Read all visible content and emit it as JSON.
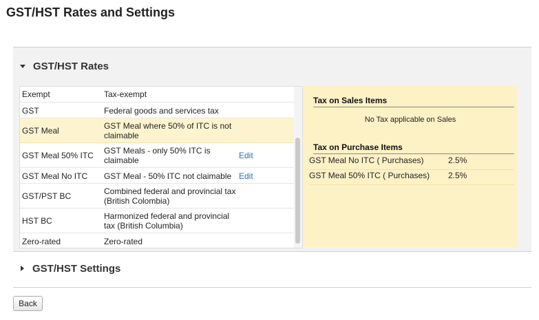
{
  "page_title": "GST/HST Rates and Settings",
  "rates_section": {
    "title": "GST/HST Rates"
  },
  "rates": [
    {
      "code": "Exempt",
      "description": "Tax-exempt",
      "edit": ""
    },
    {
      "code": "GST",
      "description": "Federal goods and services tax",
      "edit": ""
    },
    {
      "code": "GST Meal",
      "description": "GST Meal where 50% of ITC is not claimable",
      "edit": ""
    },
    {
      "code": "GST Meal 50% ITC",
      "description": "GST Meals - only 50% ITC is claimable",
      "edit": "Edit"
    },
    {
      "code": "GST Meal No ITC",
      "description": "GST Meal - 50% ITC not claimable",
      "edit": "Edit"
    },
    {
      "code": "GST/PST BC",
      "description": "Combined federal and provincial tax (British Colombia)",
      "edit": ""
    },
    {
      "code": "HST BC",
      "description": "Harmonized federal and provincial tax (British Columbia)",
      "edit": ""
    },
    {
      "code": "Zero-rated",
      "description": "Zero-rated",
      "edit": ""
    }
  ],
  "tax_panel": {
    "sales_heading": "Tax on Sales Items",
    "sales_empty": "No Tax applicable on Sales",
    "purchase_heading": "Tax on Purchase Items",
    "purchase_items": [
      {
        "name": "GST Meal No ITC ( Purchases)",
        "rate": "2.5%"
      },
      {
        "name": "GST Meal 50% ITC ( Purchases)",
        "rate": "2.5%"
      }
    ]
  },
  "settings_section": {
    "title": "GST/HST Settings"
  },
  "back_button": "Back"
}
